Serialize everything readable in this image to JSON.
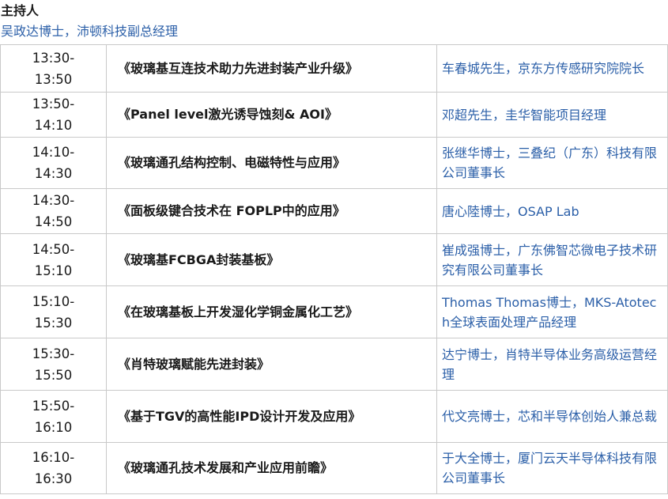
{
  "host": {
    "title": "主持人",
    "name": "吴政达博士，沛顿科技副总经理"
  },
  "sessions": [
    {
      "start": "13:30-",
      "end": "13:50",
      "topic": "《玻璃基互连技术助力先进封装产业升级》",
      "speaker": "车春城先生，京东方传感研究院院长"
    },
    {
      "start": "13:50-",
      "end": "14:10",
      "topic": "《Panel level激光诱导蚀刻& AOI》",
      "speaker": "邓超先生，圭华智能项目经理"
    },
    {
      "start": "14:10-",
      "end": "14:30",
      "topic": "《玻璃通孔结构控制、电磁特性与应用》",
      "speaker": "张继华博士，三叠纪（广东）科技有限公司董事长"
    },
    {
      "start": "14:30-",
      "end": "14:50",
      "topic": "《面板级键合技术在 FOPLP中的应用》",
      "speaker": "唐心陸博士，OSAP Lab"
    },
    {
      "start": "14:50-",
      "end": "15:10",
      "topic": "《玻璃基FCBGA封装基板》",
      "speaker": "崔成强博士，广东佛智芯微电子技术研究有限公司董事长"
    },
    {
      "start": "15:10-",
      "end": "15:30",
      "topic": "《在玻璃基板上开发湿化学铜金属化工艺》",
      "speaker": "Thomas Thomas博士，MKS-Atotech全球表面处理产品经理"
    },
    {
      "start": "15:30-",
      "end": "15:50",
      "topic": "《肖特玻璃赋能先进封装》",
      "speaker": "达宁博士，肖特半导体业务高级运营经理"
    },
    {
      "start": "15:50-",
      "end": "16:10",
      "topic": "《基于TGV的高性能IPD设计开发及应用》",
      "speaker": "代文亮博士，芯和半导体创始人兼总裁"
    },
    {
      "start": "16:10-",
      "end": "16:30",
      "topic": "《玻璃通孔技术发展和产业应用前瞻》",
      "speaker": "于大全博士，厦门云天半导体科技有限公司董事长"
    }
  ]
}
